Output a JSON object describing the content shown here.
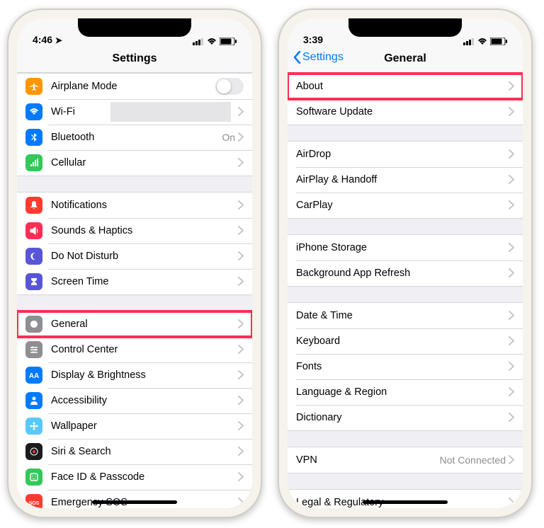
{
  "left": {
    "time": "4:46",
    "title": "Settings",
    "groups": [
      [
        {
          "icon": "airplane",
          "color": "#ff9500",
          "label": "Airplane Mode",
          "toggle": true
        },
        {
          "icon": "wifi",
          "color": "#007aff",
          "label": "Wi-Fi",
          "chev": true,
          "mask": true
        },
        {
          "icon": "bluetooth",
          "color": "#007aff",
          "label": "Bluetooth",
          "detail": "On",
          "chev": true
        },
        {
          "icon": "cellular",
          "color": "#34c759",
          "label": "Cellular",
          "chev": true
        }
      ],
      [
        {
          "icon": "bell",
          "color": "#ff3b30",
          "label": "Notifications",
          "chev": true
        },
        {
          "icon": "speaker",
          "color": "#ff2d55",
          "label": "Sounds & Haptics",
          "chev": true
        },
        {
          "icon": "moon",
          "color": "#5856d6",
          "label": "Do Not Disturb",
          "chev": true
        },
        {
          "icon": "hourglass",
          "color": "#5856d6",
          "label": "Screen Time",
          "chev": true
        }
      ],
      [
        {
          "icon": "gear",
          "color": "#8e8e93",
          "label": "General",
          "chev": true,
          "highlight": true
        },
        {
          "icon": "sliders",
          "color": "#8e8e93",
          "label": "Control Center",
          "chev": true
        },
        {
          "icon": "aa",
          "color": "#007aff",
          "label": "Display & Brightness",
          "chev": true
        },
        {
          "icon": "person",
          "color": "#007aff",
          "label": "Accessibility",
          "chev": true
        },
        {
          "icon": "flower",
          "color": "#5ac8fa",
          "label": "Wallpaper",
          "chev": true
        },
        {
          "icon": "siri",
          "color": "#1c1c1e",
          "label": "Siri & Search",
          "chev": true
        },
        {
          "icon": "faceid",
          "color": "#34c759",
          "label": "Face ID & Passcode",
          "chev": true
        },
        {
          "icon": "sos",
          "color": "#ff3b30",
          "label": "Emergency SOS",
          "chev": true
        }
      ]
    ]
  },
  "right": {
    "time": "3:39",
    "back": "Settings",
    "title": "General",
    "groups": [
      [
        {
          "label": "About",
          "chev": true,
          "highlight": true
        },
        {
          "label": "Software Update",
          "chev": true
        }
      ],
      [
        {
          "label": "AirDrop",
          "chev": true
        },
        {
          "label": "AirPlay & Handoff",
          "chev": true
        },
        {
          "label": "CarPlay",
          "chev": true
        }
      ],
      [
        {
          "label": "iPhone Storage",
          "chev": true
        },
        {
          "label": "Background App Refresh",
          "chev": true
        }
      ],
      [
        {
          "label": "Date & Time",
          "chev": true
        },
        {
          "label": "Keyboard",
          "chev": true
        },
        {
          "label": "Fonts",
          "chev": true
        },
        {
          "label": "Language & Region",
          "chev": true
        },
        {
          "label": "Dictionary",
          "chev": true
        }
      ],
      [
        {
          "label": "VPN",
          "detail": "Not Connected",
          "chev": true
        }
      ],
      [
        {
          "label": "Legal & Regulatory",
          "chev": true
        }
      ]
    ]
  },
  "icons": {
    "signal": "▪▪▪▫",
    "wifi_glyph": "⌃",
    "battery": "■"
  }
}
